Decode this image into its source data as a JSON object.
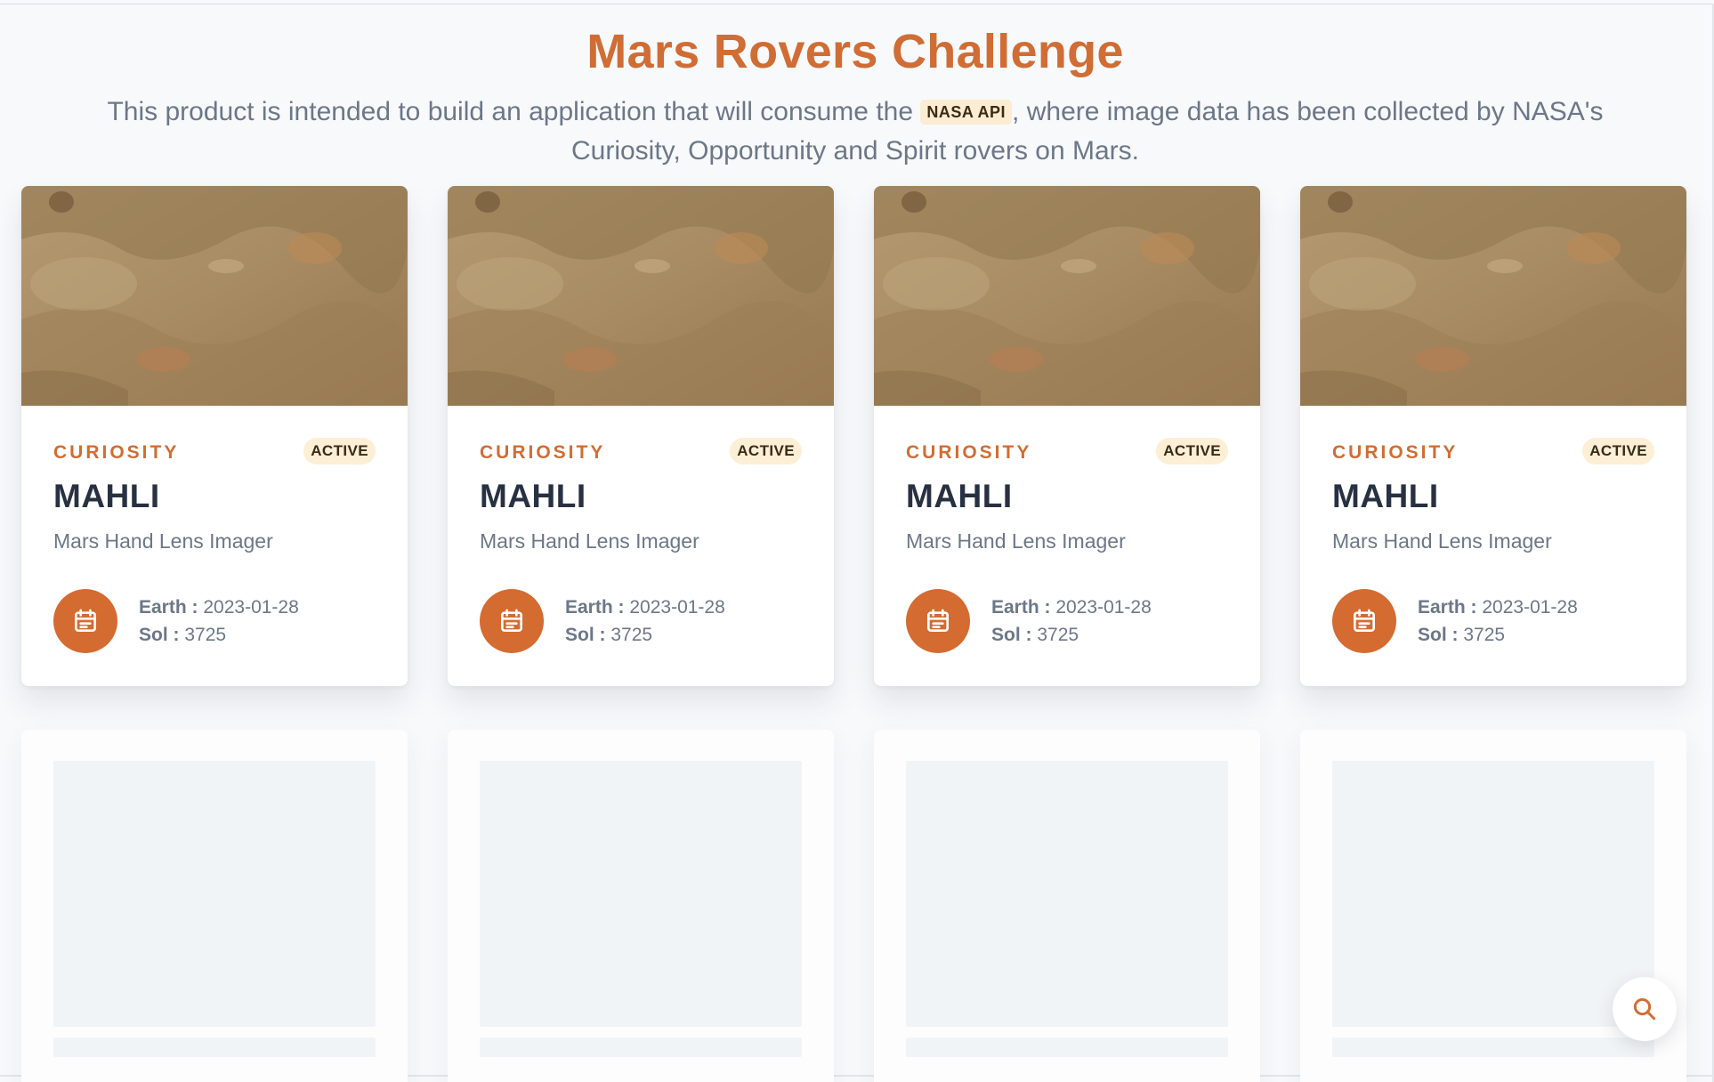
{
  "header": {
    "title": "Mars Rovers Challenge",
    "intro_before": "This product is intended to build an application that will consume the ",
    "api_badge": "NASA API",
    "intro_after": ", where image data has been collected by NASA's Curiosity, Opportunity and Spirit rovers on Mars."
  },
  "cards": [
    {
      "rover": "CURIOSITY",
      "status": "ACTIVE",
      "camera_short": "MAHLI",
      "camera_full": "Mars Hand Lens Imager",
      "earth_label": "Earth :",
      "earth_date": "2023-01-28",
      "sol_label": "Sol :",
      "sol": "3725"
    },
    {
      "rover": "CURIOSITY",
      "status": "ACTIVE",
      "camera_short": "MAHLI",
      "camera_full": "Mars Hand Lens Imager",
      "earth_label": "Earth :",
      "earth_date": "2023-01-28",
      "sol_label": "Sol :",
      "sol": "3725"
    },
    {
      "rover": "CURIOSITY",
      "status": "ACTIVE",
      "camera_short": "MAHLI",
      "camera_full": "Mars Hand Lens Imager",
      "earth_label": "Earth :",
      "earth_date": "2023-01-28",
      "sol_label": "Sol :",
      "sol": "3725"
    },
    {
      "rover": "CURIOSITY",
      "status": "ACTIVE",
      "camera_short": "MAHLI",
      "camera_full": "Mars Hand Lens Imager",
      "earth_label": "Earth :",
      "earth_date": "2023-01-28",
      "sol_label": "Sol :",
      "sol": "3725"
    }
  ],
  "icons": {
    "calendar": "calendar-icon",
    "search": "search-icon"
  },
  "colors": {
    "accent": "#d06d35",
    "title_dark": "#283142",
    "muted_text": "#6c7788",
    "badge_bg": "#fcefd6",
    "skeleton": "#f1f4f7"
  }
}
